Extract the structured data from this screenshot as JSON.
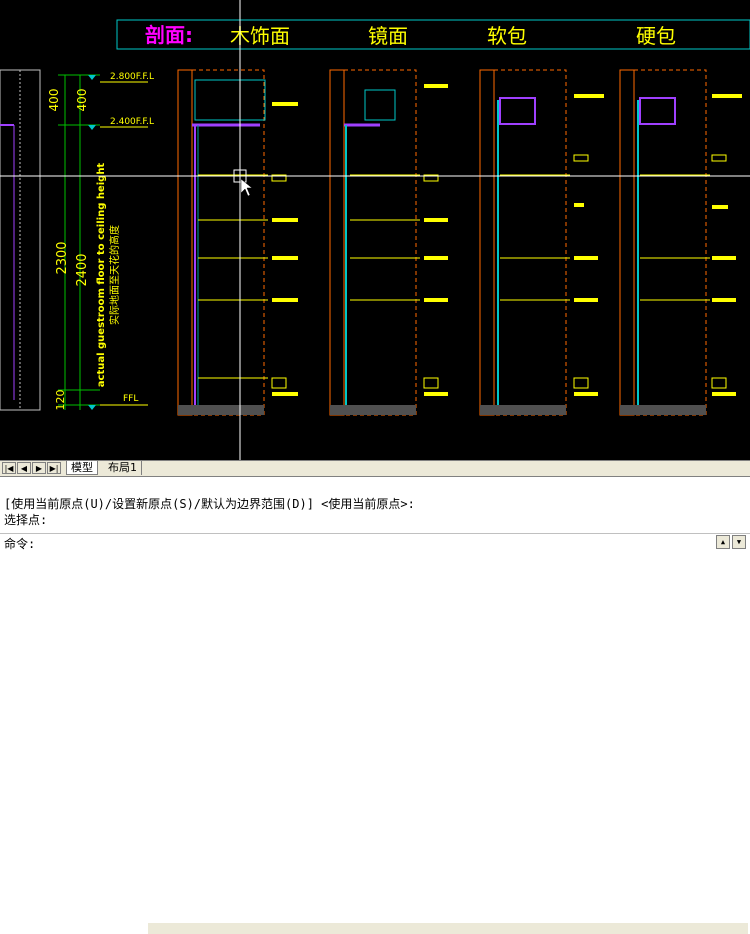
{
  "drawing": {
    "header_label": "剖面:",
    "section_titles": [
      "木饰面",
      "镜面",
      "软包",
      "硬包"
    ],
    "level_top": "2.800F.F.L",
    "level_mid": "2.400F.F.L",
    "level_floor": "FFL",
    "dim_400a": "400",
    "dim_400b": "400",
    "dim_2300": "2300",
    "dim_2400": "2400",
    "dim_120": "120",
    "vertical_note_en": "actual guestroom floor to ceiling height",
    "vertical_note_cn": "实际地面至天花的高度",
    "small_dim": "2300"
  },
  "colors": {
    "title_magenta": "#ff00ff",
    "title_yellow": "#ffff00",
    "frame_cyan": "#00c8c8",
    "wall_orange": "#ff6a00",
    "panel_purple": "#a040ff",
    "panel_teal": "#00a0a0",
    "green": "#00c000",
    "white": "#ffffff"
  },
  "tabs": {
    "nav_first": "|◀",
    "nav_prev": "◀",
    "nav_next": "▶",
    "nav_last": "▶|",
    "model": "模型",
    "layout1": "布局1"
  },
  "command": {
    "history_line1": "[使用当前原点(U)/设置新原点(S)/默认为边界范围(D)] <使用当前原点>:",
    "history_line2": "选择点:",
    "prompt": "命令:"
  },
  "scroll": {
    "up": "▲",
    "down": "▼"
  }
}
